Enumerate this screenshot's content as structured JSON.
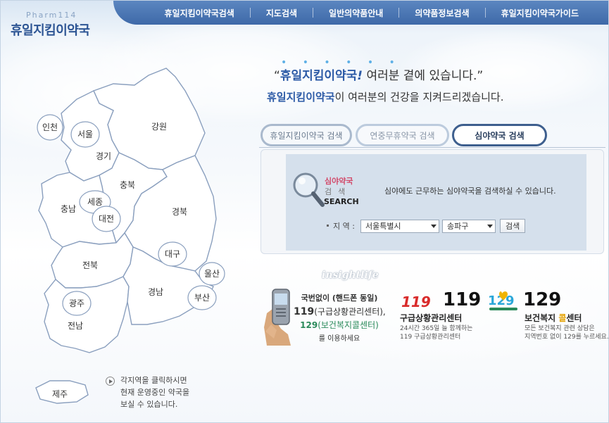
{
  "logo": {
    "small": "Pharm114",
    "main": "휴일지킴이약국"
  },
  "nav": {
    "items": [
      "휴일지킴이약국검색",
      "지도검색",
      "일반의약품안내",
      "의약품정보검색",
      "휴일지킴이약국가이드"
    ]
  },
  "slogan": {
    "dots": "• • • • • •",
    "line1_open": "“",
    "line1_brand": "휴일지킴이약국",
    "line1_mark": "!",
    "line1_rest": " 여러분 곁에 있습니다.”",
    "line2_brand": "휴일지킴이약국",
    "line2_rest": "이 여러분의 건강을 지켜드리겠습니다."
  },
  "tabs": {
    "items": [
      "휴일지킴이약국 검색",
      "연중무휴약국 검색",
      "심야약국 검색"
    ],
    "active": 2
  },
  "search": {
    "graphic_title1": "심야약국",
    "graphic_title2": "검색",
    "graphic_title3": "SEARCH",
    "description": "심야에도 근무하는 심야약국을 검색하실 수 있습니다.",
    "region_label": "지 역 :",
    "city_value": "서울특별시",
    "district_value": "송파구",
    "button": "검색"
  },
  "map": {
    "regions": {
      "gyeonggi": "경기",
      "gangwon": "강원",
      "chungbuk": "충북",
      "chungnam": "충남",
      "gyeongbuk": "경북",
      "jeonbuk": "전북",
      "jeonnam": "전남",
      "gyeongnam": "경남",
      "jeju": "제주"
    },
    "cities": {
      "incheon": "인천",
      "seoul": "서울",
      "sejong": "세종",
      "daejeon": "대전",
      "daegu": "대구",
      "ulsan": "울산",
      "busan": "부산",
      "gwangju": "광주"
    },
    "note": "각지역을 클릭하시면\n현재 운영중인 약국을\n보실 수 있습니다."
  },
  "info": {
    "sponsor_logo": "insightlife",
    "c1_line1": "국번없이 (핸드폰 동일)",
    "c1_line2_num": "119",
    "c1_line2_rest": "(구급상황관리센터),",
    "c1_line3_num": "129",
    "c1_line3_rest": "(보건복지콜센터)",
    "c1_line4": "를 이용하세요",
    "c2_logo": "119",
    "c2_number": "119",
    "c2_title": "구급상황관리센터",
    "c2_sub": "24시간 365일 늘 함께하는\n119 구급상황관리센터",
    "c3_logo": "129",
    "c3_number": "129",
    "c3_title_pre": "보건복지 ",
    "c3_title_hl": "콜",
    "c3_title_post": "센터",
    "c3_sub": "모든 보건복지 관련 상담은\n지역번호 없이 129를 누르세요."
  },
  "colors": {
    "nav_bg": "#3e69a8",
    "brand_blue": "#2c5aa6",
    "panel_bg": "#d5e0ec",
    "map_stroke": "#8a9fbe",
    "green_129": "#2a8a5a",
    "red_119": "#d92b2b"
  }
}
